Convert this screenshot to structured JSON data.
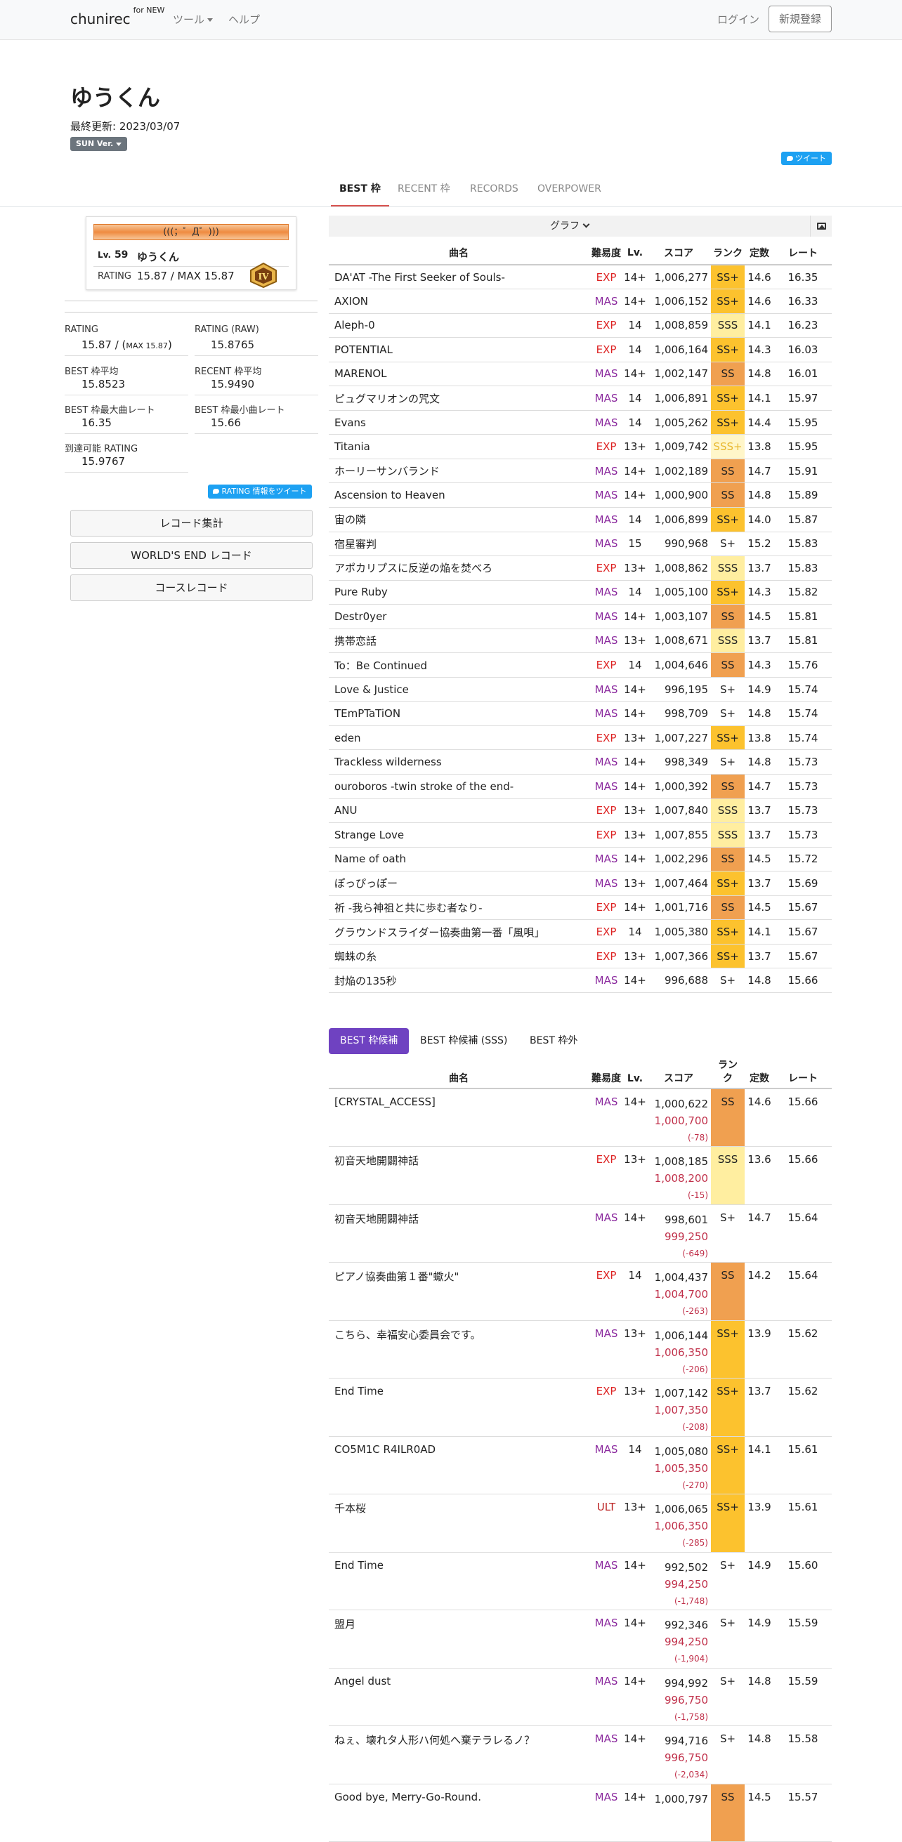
{
  "nav": {
    "brand": "chunirec",
    "brand_sup": "for NEW",
    "tools": "ツール",
    "help": "ヘルプ",
    "login": "ログイン",
    "signup": "新規登録"
  },
  "profile": {
    "name": "ゆうくん",
    "updated": "最終更新: 2023/03/07",
    "version": "SUN Ver.",
    "tweet": "ツイート"
  },
  "tabs": [
    "BEST 枠",
    "RECENT 枠",
    "RECORDS",
    "OVERPOWER"
  ],
  "card": {
    "banner": "(((；゜Д゜)))",
    "lv_label": "Lv.",
    "lv": "59",
    "name": "ゆうくん",
    "rating_label": "RATING",
    "rating": "15.87 / MAX 15.87"
  },
  "stats": {
    "rating_label": "RATING",
    "rating_value": "15.87 / (",
    "rating_max": "MAX 15.87",
    "rating_close": ")",
    "raw_label": "RATING (RAW)",
    "raw_value": "15.8765",
    "best_avg_label": "BEST 枠平均",
    "best_avg": "15.8523",
    "recent_avg_label": "RECENT 枠平均",
    "recent_avg": "15.9490",
    "best_max_label": "BEST 枠最大曲レート",
    "best_max": "16.35",
    "best_min_label": "BEST 枠最小曲レート",
    "best_min": "15.66",
    "reach_label": "到達可能 RATING",
    "reach": "15.9767",
    "rating_tweet": "RATING 情報をツイート"
  },
  "side_buttons": [
    "レコード集計",
    "WORLD'S END レコード",
    "コースレコード"
  ],
  "graph_label": "グラフ",
  "best_headers": [
    "曲名",
    "難易度",
    "Lv.",
    "スコア",
    "ランク",
    "定数",
    "レート"
  ],
  "best": [
    [
      "DA'AT -The First Seeker of Souls-",
      "EXP",
      "14+",
      "1,006,277",
      "SS+",
      "14.6",
      "16.35"
    ],
    [
      "AXION",
      "MAS",
      "14+",
      "1,006,152",
      "SS+",
      "14.6",
      "16.33"
    ],
    [
      "Aleph-0",
      "EXP",
      "14",
      "1,008,859",
      "SSS",
      "14.1",
      "16.23"
    ],
    [
      "POTENTIAL",
      "EXP",
      "14",
      "1,006,164",
      "SS+",
      "14.3",
      "16.03"
    ],
    [
      "MARENOL",
      "MAS",
      "14+",
      "1,002,147",
      "SS",
      "14.8",
      "16.01"
    ],
    [
      "ピュグマリオンの咒文",
      "MAS",
      "14",
      "1,006,891",
      "SS+",
      "14.1",
      "15.97"
    ],
    [
      "Evans",
      "MAS",
      "14",
      "1,005,262",
      "SS+",
      "14.4",
      "15.95"
    ],
    [
      "Titania",
      "EXP",
      "13+",
      "1,009,742",
      "SSS+",
      "13.8",
      "15.95"
    ],
    [
      "ホーリーサンバランド",
      "MAS",
      "14+",
      "1,002,189",
      "SS",
      "14.7",
      "15.91"
    ],
    [
      "Ascension to Heaven",
      "MAS",
      "14+",
      "1,000,900",
      "SS",
      "14.8",
      "15.89"
    ],
    [
      "宙の隣",
      "MAS",
      "14",
      "1,006,899",
      "SS+",
      "14.0",
      "15.87"
    ],
    [
      "宿星審判",
      "MAS",
      "15",
      "990,968",
      "S+",
      "15.2",
      "15.83"
    ],
    [
      "アポカリプスに反逆の焔を焚べろ",
      "EXP",
      "13+",
      "1,008,862",
      "SSS",
      "13.7",
      "15.83"
    ],
    [
      "Pure Ruby",
      "MAS",
      "14",
      "1,005,100",
      "SS+",
      "14.3",
      "15.82"
    ],
    [
      "Destr0yer",
      "MAS",
      "14+",
      "1,003,107",
      "SS",
      "14.5",
      "15.81"
    ],
    [
      "携帯恋話",
      "MAS",
      "13+",
      "1,008,671",
      "SSS",
      "13.7",
      "15.81"
    ],
    [
      "To：Be Continued",
      "EXP",
      "14",
      "1,004,646",
      "SS",
      "14.3",
      "15.76"
    ],
    [
      "Love & Justice",
      "MAS",
      "14+",
      "996,195",
      "S+",
      "14.9",
      "15.74"
    ],
    [
      "TEmPTaTiON",
      "MAS",
      "14+",
      "998,709",
      "S+",
      "14.8",
      "15.74"
    ],
    [
      "eden",
      "EXP",
      "13+",
      "1,007,227",
      "SS+",
      "13.8",
      "15.74"
    ],
    [
      "Trackless wilderness",
      "MAS",
      "14+",
      "998,349",
      "S+",
      "14.8",
      "15.73"
    ],
    [
      "ouroboros -twin stroke of the end-",
      "MAS",
      "14+",
      "1,000,392",
      "SS",
      "14.7",
      "15.73"
    ],
    [
      "ANU",
      "EXP",
      "13+",
      "1,007,840",
      "SSS",
      "13.7",
      "15.73"
    ],
    [
      "Strange Love",
      "EXP",
      "13+",
      "1,007,855",
      "SSS",
      "13.7",
      "15.73"
    ],
    [
      "Name of oath",
      "MAS",
      "14+",
      "1,002,296",
      "SS",
      "14.5",
      "15.72"
    ],
    [
      "ぽっぴっぽー",
      "MAS",
      "13+",
      "1,007,464",
      "SS+",
      "13.7",
      "15.69"
    ],
    [
      "祈 -我ら神祖と共に歩む者なり-",
      "EXP",
      "14+",
      "1,001,716",
      "SS",
      "14.5",
      "15.67"
    ],
    [
      "グラウンドスライダー協奏曲第一番「風唄」",
      "EXP",
      "14",
      "1,005,380",
      "SS+",
      "14.1",
      "15.67"
    ],
    [
      "蜘蛛の糸",
      "EXP",
      "13+",
      "1,007,366",
      "SS+",
      "13.7",
      "15.67"
    ],
    [
      "封焔の135秒",
      "MAS",
      "14+",
      "996,688",
      "S+",
      "14.8",
      "15.66"
    ]
  ],
  "pills": [
    "BEST 枠候補",
    "BEST 枠候補 (SSS)",
    "BEST 枠外"
  ],
  "cand_headers": [
    "曲名",
    "難易度",
    "Lv.",
    "スコア",
    "ランク",
    "定数",
    "レート"
  ],
  "cand_rank_header": [
    "ラン",
    "ク"
  ],
  "cand": [
    [
      "[CRYSTAL_ACCESS]",
      "MAS",
      "14+",
      "1,000,622",
      "1,000,700",
      "(-78)",
      "SS",
      "14.6",
      "15.66"
    ],
    [
      "初音天地開闢神話",
      "EXP",
      "13+",
      "1,008,185",
      "1,008,200",
      "(-15)",
      "SSS",
      "13.6",
      "15.66"
    ],
    [
      "初音天地開闢神話",
      "MAS",
      "14+",
      "998,601",
      "999,250",
      "(-649)",
      "S+",
      "14.7",
      "15.64"
    ],
    [
      "ピアノ協奏曲第１番\"蠍火\"",
      "EXP",
      "14",
      "1,004,437",
      "1,004,700",
      "(-263)",
      "SS",
      "14.2",
      "15.64"
    ],
    [
      "こちら、幸福安心委員会です。",
      "MAS",
      "13+",
      "1,006,144",
      "1,006,350",
      "(-206)",
      "SS+",
      "13.9",
      "15.62"
    ],
    [
      "End Time",
      "EXP",
      "13+",
      "1,007,142",
      "1,007,350",
      "(-208)",
      "SS+",
      "13.7",
      "15.62"
    ],
    [
      "CO5M1C R4ILR0AD",
      "MAS",
      "14",
      "1,005,080",
      "1,005,350",
      "(-270)",
      "SS+",
      "14.1",
      "15.61"
    ],
    [
      "千本桜",
      "ULT",
      "13+",
      "1,006,065",
      "1,006,350",
      "(-285)",
      "SS+",
      "13.9",
      "15.61"
    ],
    [
      "End Time",
      "MAS",
      "14+",
      "992,502",
      "994,250",
      "(-1,748)",
      "S+",
      "14.9",
      "15.60"
    ],
    [
      "盟月",
      "MAS",
      "14+",
      "992,346",
      "994,250",
      "(-1,904)",
      "S+",
      "14.9",
      "15.59"
    ],
    [
      "Angel dust",
      "MAS",
      "14+",
      "994,992",
      "996,750",
      "(-1,758)",
      "S+",
      "14.8",
      "15.59"
    ],
    [
      "ねぇ、壊れタ人形ハ何処へ棄テラレるノ？",
      "MAS",
      "14+",
      "994,716",
      "996,750",
      "(-2,034)",
      "S+",
      "14.8",
      "15.58"
    ],
    [
      "Good bye, Merry-Go-Round.",
      "MAS",
      "14+",
      "1,000,797",
      "",
      "",
      "SS",
      "14.5",
      "15.57"
    ]
  ]
}
